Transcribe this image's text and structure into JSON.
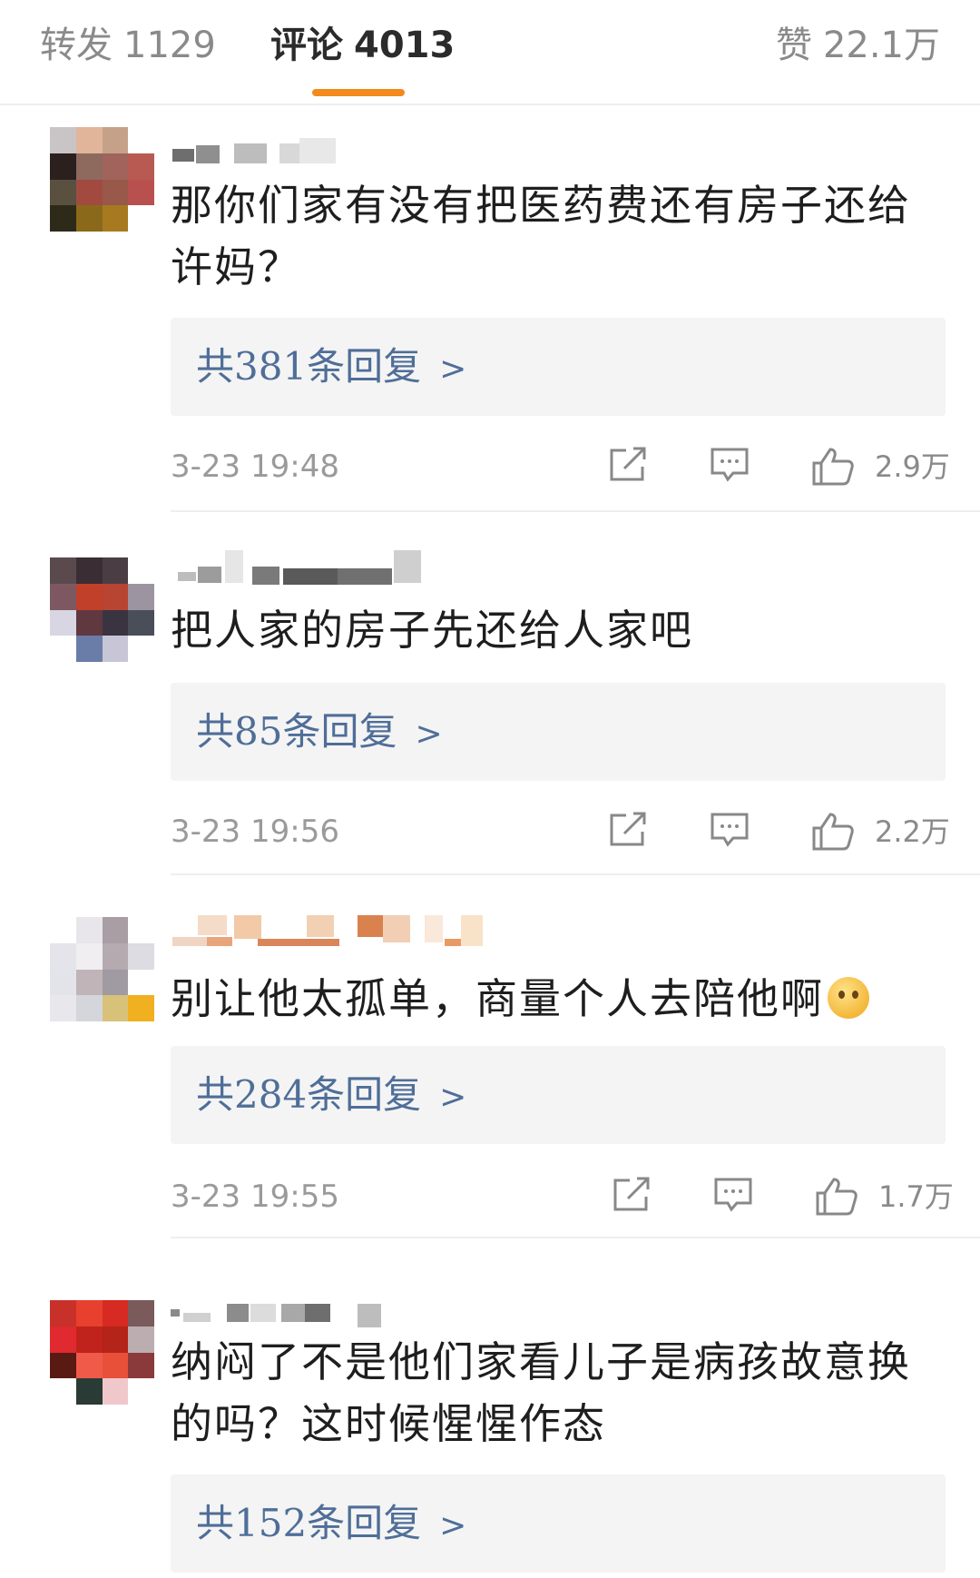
{
  "tabs": {
    "forward": {
      "label": "转发",
      "count": "1129"
    },
    "comments": {
      "label": "评论",
      "count": "4013"
    },
    "likes": {
      "label": "赞",
      "count": "22.1万"
    }
  },
  "comments": [
    {
      "text": "那你们家有没有把医药费还有房子还给许妈？",
      "reply_label": "共381条回复",
      "timestamp": "3-23 19:48",
      "like_count": "2.9万"
    },
    {
      "text": "把人家的房子先还给人家吧",
      "reply_label": "共85条回复",
      "timestamp": "3-23 19:56",
      "like_count": "2.2万"
    },
    {
      "text": "别让他太孤单，商量个人去陪他啊",
      "reply_label": "共284条回复",
      "timestamp": "3-23 19:55",
      "like_count": "1.7万"
    },
    {
      "text": "纳闷了不是他们家看儿子是病孩故意换的吗？这时候惺惺作态",
      "reply_label": "共152条回复"
    }
  ],
  "icons": {
    "share": "share-icon",
    "reply": "comment-icon",
    "like": "thumbs-up-icon",
    "emoji": "thinking-face-emoji"
  },
  "colors": {
    "accent": "#f28b1c",
    "link": "#4f6e98",
    "muted": "#9a9a9a"
  }
}
